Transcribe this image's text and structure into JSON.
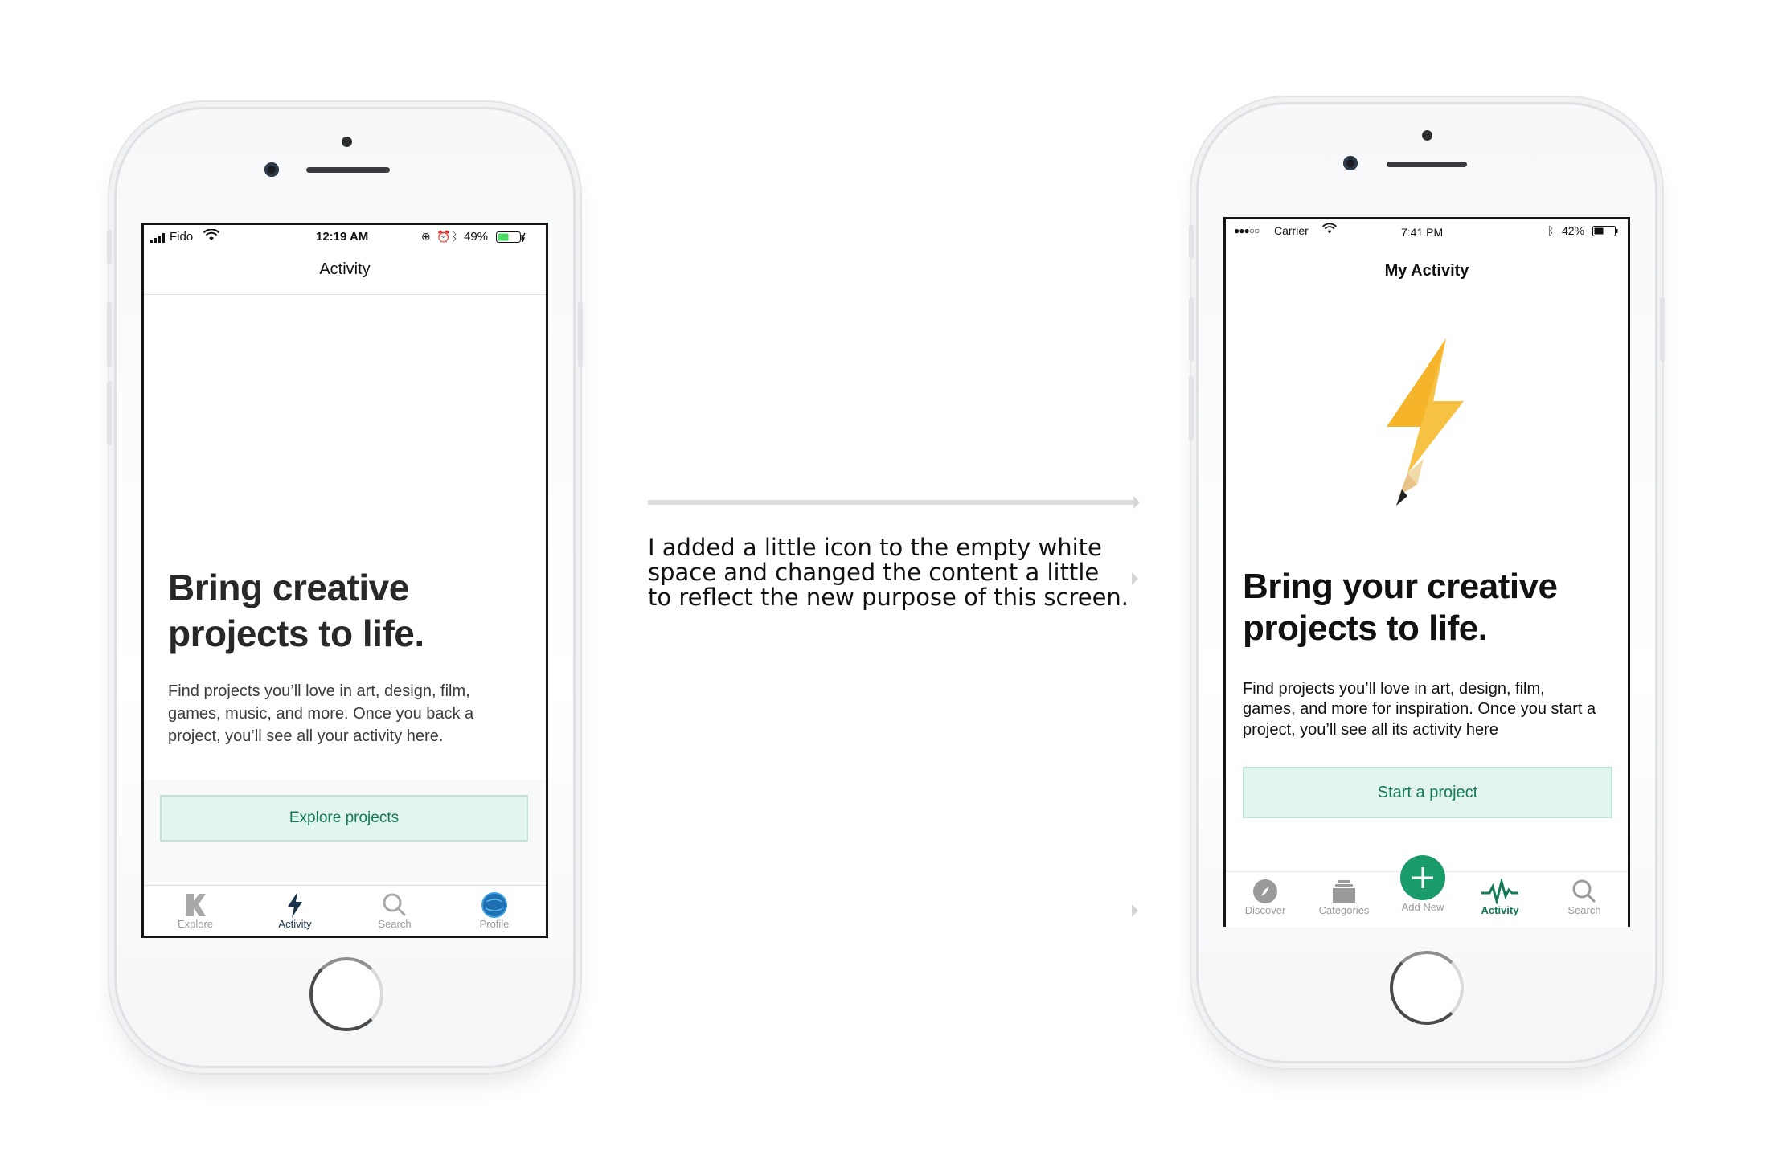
{
  "left_phone": {
    "status": {
      "carrier": "Fido",
      "time": "12:19 AM",
      "battery": "49%"
    },
    "nav_title": "Activity",
    "headline_line1": "Bring creative",
    "headline_line2": "projects to life.",
    "body": "Find projects you’ll love in art, design, film, games, music, and more. Once you back a project, you’ll see all your activity here.",
    "cta_label": "Explore projects",
    "tabs": [
      {
        "label": "Explore",
        "icon": "kickstarter-k-icon"
      },
      {
        "label": "Activity",
        "icon": "lightning-icon",
        "active": true
      },
      {
        "label": "Search",
        "icon": "search-icon"
      },
      {
        "label": "Profile",
        "icon": "avatar-globe-icon"
      }
    ]
  },
  "caption": {
    "line1": "I added a little icon to the empty white",
    "line2": "space and changed the content a little",
    "line3": "to reflect the new purpose of this screen."
  },
  "right_phone": {
    "status": {
      "carrier": "Carrier",
      "time": "7:41 PM",
      "battery": "42%"
    },
    "nav_title": "My Activity",
    "headline_line1": "Bring your creative",
    "headline_line2": "projects to life.",
    "body": "Find projects you’ll love in art, design, film, games, and more for inspiration. Once you start a project, you’ll see all its activity here",
    "cta_label": "Start a project",
    "tabs": [
      {
        "label": "Discover",
        "icon": "compass-icon"
      },
      {
        "label": "Categories",
        "icon": "stack-icon"
      },
      {
        "label": "Add New",
        "icon": "plus-icon"
      },
      {
        "label": "Activity",
        "icon": "pulse-icon",
        "active": true
      },
      {
        "label": "Search",
        "icon": "search-icon"
      }
    ]
  },
  "colors": {
    "accent_green": "#127a55",
    "cta_bg": "#e2f4ee",
    "add_button": "#1a9b6a",
    "bolt_yellow": "#f6b42b",
    "active_tab_dark": "#17324a"
  }
}
